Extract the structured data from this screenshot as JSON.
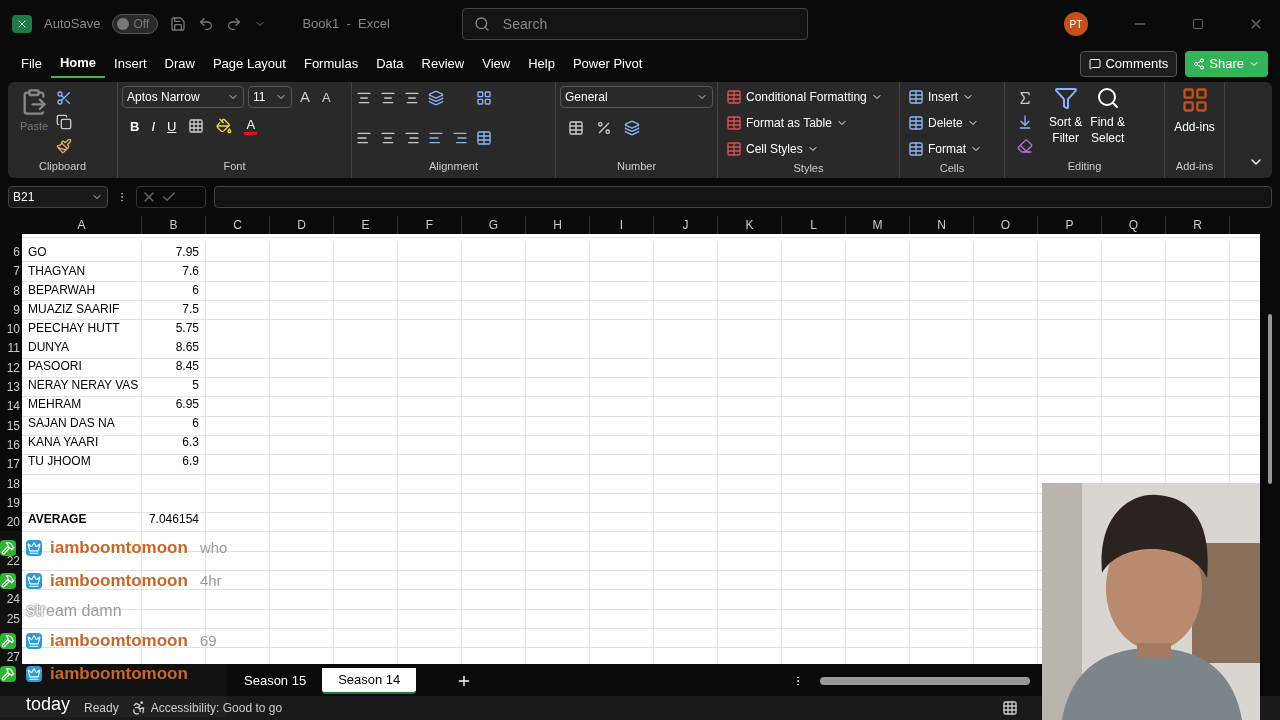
{
  "title_bar": {
    "autosave_label": "AutoSave",
    "autosave_on": false,
    "autosave_state": "Off",
    "document_title": "Book1  -  Excel",
    "search_placeholder": "Search",
    "user_initials": "PT"
  },
  "menu_tabs": [
    {
      "label": "File",
      "selected": false
    },
    {
      "label": "Home",
      "selected": true
    },
    {
      "label": "Insert",
      "selected": false
    },
    {
      "label": "Draw",
      "selected": false
    },
    {
      "label": "Page Layout",
      "selected": false
    },
    {
      "label": "Formulas",
      "selected": false
    },
    {
      "label": "Data",
      "selected": false
    },
    {
      "label": "Review",
      "selected": false
    },
    {
      "label": "View",
      "selected": false
    },
    {
      "label": "Help",
      "selected": false
    },
    {
      "label": "Power Pivot",
      "selected": false
    }
  ],
  "comments_label": "Comments",
  "share_label": "Share",
  "ribbon": {
    "clipboard": {
      "paste_label": "Paste",
      "label": "Clipboard"
    },
    "font": {
      "font_name": "Aptos Narrow",
      "font_size": "11",
      "grow_label": "A",
      "shrink_label": "A",
      "bold_label": "B",
      "italic_label": "I",
      "underline_label": "U",
      "font_color_label": "A",
      "label": "Font"
    },
    "alignment": {
      "label": "Alignment"
    },
    "number": {
      "format": "General",
      "label": "Number"
    },
    "styles": {
      "items": [
        "Conditional Formatting",
        "Format as Table",
        "Cell Styles"
      ],
      "label": "Styles"
    },
    "cells": {
      "items": [
        "Insert",
        "Delete",
        "Format"
      ],
      "label": "Cells"
    },
    "editing": {
      "sort_label": "Sort &",
      "sort_label_2": "Filter",
      "find_label": "Find &",
      "find_label_2": "Select",
      "label": "Editing"
    },
    "addins": {
      "button_label": "Add-ins",
      "label": "Add-ins"
    }
  },
  "formula_bar": {
    "name_box": "B21"
  },
  "columns": [
    "A",
    "B",
    "C",
    "D",
    "E",
    "F",
    "G",
    "H",
    "I",
    "J",
    "K",
    "L",
    "M",
    "N",
    "O",
    "P",
    "Q",
    "R"
  ],
  "rows": [
    {
      "number": "6",
      "a": "GO",
      "b": "7.95",
      "bold": false
    },
    {
      "number": "7",
      "a": "THAGYAN",
      "b": "7.6",
      "bold": false
    },
    {
      "number": "8",
      "a": "BEPARWAH",
      "b": "6",
      "bold": false
    },
    {
      "number": "9",
      "a": "MUAZIZ SAARIF",
      "b": "7.5",
      "bold": false
    },
    {
      "number": "10",
      "a": "PEECHAY HUTT",
      "b": "5.75",
      "bold": false
    },
    {
      "number": "11",
      "a": "DUNYA",
      "b": "8.65",
      "bold": false
    },
    {
      "number": "12",
      "a": "PASOORI",
      "b": "8.45",
      "bold": false
    },
    {
      "number": "13",
      "a": "NERAY NERAY VAS",
      "b": "5",
      "bold": false
    },
    {
      "number": "14",
      "a": "MEHRAM",
      "b": "6.95",
      "bold": false
    },
    {
      "number": "15",
      "a": "SAJAN DAS NA",
      "b": "6",
      "bold": false
    },
    {
      "number": "16",
      "a": "KANA YAARI",
      "b": "6.3",
      "bold": false
    },
    {
      "number": "17",
      "a": "TU JHOOM",
      "b": "6.9",
      "bold": false
    },
    {
      "number": "18"
    },
    {
      "number": "19"
    },
    {
      "number": "20",
      "a": "AVERAGE",
      "b": "7.046154",
      "bold": true
    },
    {},
    {
      "number": "22"
    },
    {},
    {
      "number": "24"
    },
    {
      "number": "25"
    },
    {},
    {
      "number": "27"
    }
  ],
  "chat": [
    {
      "kind": "message",
      "user": "iamboomtomoon",
      "text": "who"
    },
    {
      "kind": "message",
      "user": "iamboomtomoon",
      "text": "4hr"
    },
    {
      "kind": "continuation",
      "lead": "str",
      "text": "eam damn"
    },
    {
      "kind": "message",
      "user": "iamboomtomoon",
      "text": "69"
    },
    {
      "kind": "message",
      "user": "iamboomtomoon"
    },
    {
      "kind": "continuation",
      "lead": "today"
    }
  ],
  "sheet_tabs": [
    {
      "label": "Season 15",
      "selected": false
    },
    {
      "label": "Season 14",
      "selected": true
    }
  ],
  "status_bar": {
    "ready": "Ready",
    "accessibility": "Accessibility: Good to go"
  }
}
